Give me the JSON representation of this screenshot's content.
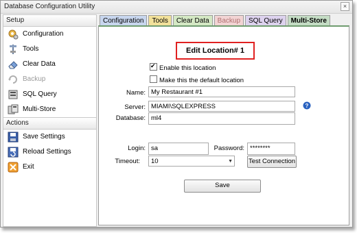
{
  "window": {
    "title": "Database Configuration Utility",
    "close_glyph": "×"
  },
  "sidebar": {
    "setup_header": "Setup",
    "setup_items": [
      {
        "label": "Configuration",
        "icon": "configuration-icon"
      },
      {
        "label": "Tools",
        "icon": "tools-icon"
      },
      {
        "label": "Clear Data",
        "icon": "eraser-icon"
      },
      {
        "label": "Backup",
        "icon": "backup-icon"
      },
      {
        "label": "SQL Query",
        "icon": "sql-query-icon"
      },
      {
        "label": "Multi-Store",
        "icon": "multi-store-icon"
      }
    ],
    "actions_header": "Actions",
    "action_items": [
      {
        "label": "Save Settings",
        "icon": "save-icon"
      },
      {
        "label": "Reload Settings",
        "icon": "reload-icon"
      },
      {
        "label": "Exit",
        "icon": "exit-icon"
      }
    ]
  },
  "tabs": [
    "Configuration",
    "Tools",
    "Clear Data",
    "Backup",
    "SQL Query",
    "Multi-Store"
  ],
  "form": {
    "heading": "Edit Location# 1",
    "enable_label": "Enable this location",
    "enable_checked": true,
    "default_label": "Make this the default location",
    "default_checked": false,
    "name_label": "Name:",
    "name_value": "My Restaurant #1",
    "server_label": "Server:",
    "server_value": "MIAMI\\SQLEXPRESS",
    "database_label": "Database:",
    "database_value": "ml4",
    "login_label": "Login:",
    "login_value": "sa",
    "password_label": "Password:",
    "password_value": "********",
    "timeout_label": "Timeout:",
    "timeout_value": "10",
    "test_button": "Test Connection",
    "save_button": "Save",
    "help_glyph": "?"
  }
}
